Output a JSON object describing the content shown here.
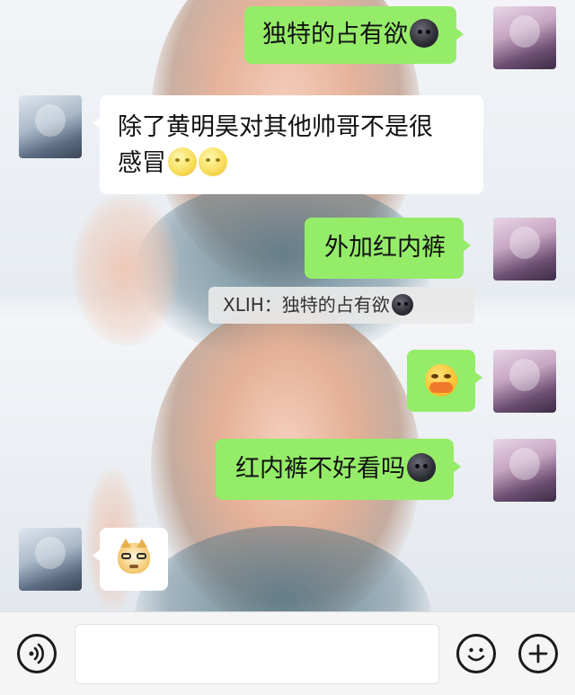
{
  "messages": [
    {
      "side": "right",
      "text": "独特的占有欲",
      "emoji": [
        "dark-moon-face"
      ]
    },
    {
      "side": "left",
      "line1": "除了黄明昊对其他帅哥不是很",
      "line2": "感冒",
      "emoji": [
        "full-moon-face",
        "full-moon-face"
      ]
    },
    {
      "side": "right",
      "text": "外加红内裤"
    },
    {
      "side": "quote",
      "sender": "XLIH",
      "separator": "：",
      "text": "独特的占有欲",
      "emoji": [
        "dark-moon-face"
      ]
    },
    {
      "side": "right",
      "sticker": "hand-over-mouth-face"
    },
    {
      "side": "right",
      "text": "红内裤不好看吗",
      "emoji": [
        "dark-moon-face"
      ]
    },
    {
      "side": "left",
      "sticker": "cat-with-glasses"
    }
  ],
  "input_bar": {
    "voice_icon": "voice-icon",
    "emoji_icon": "smiley-icon",
    "add_icon": "plus-icon",
    "field_value": ""
  },
  "colors": {
    "bubble_self": "#95ec69",
    "bubble_other": "#ffffff",
    "quote_bg": "#e8e8e8",
    "input_bar_bg": "#f5f5f5"
  }
}
